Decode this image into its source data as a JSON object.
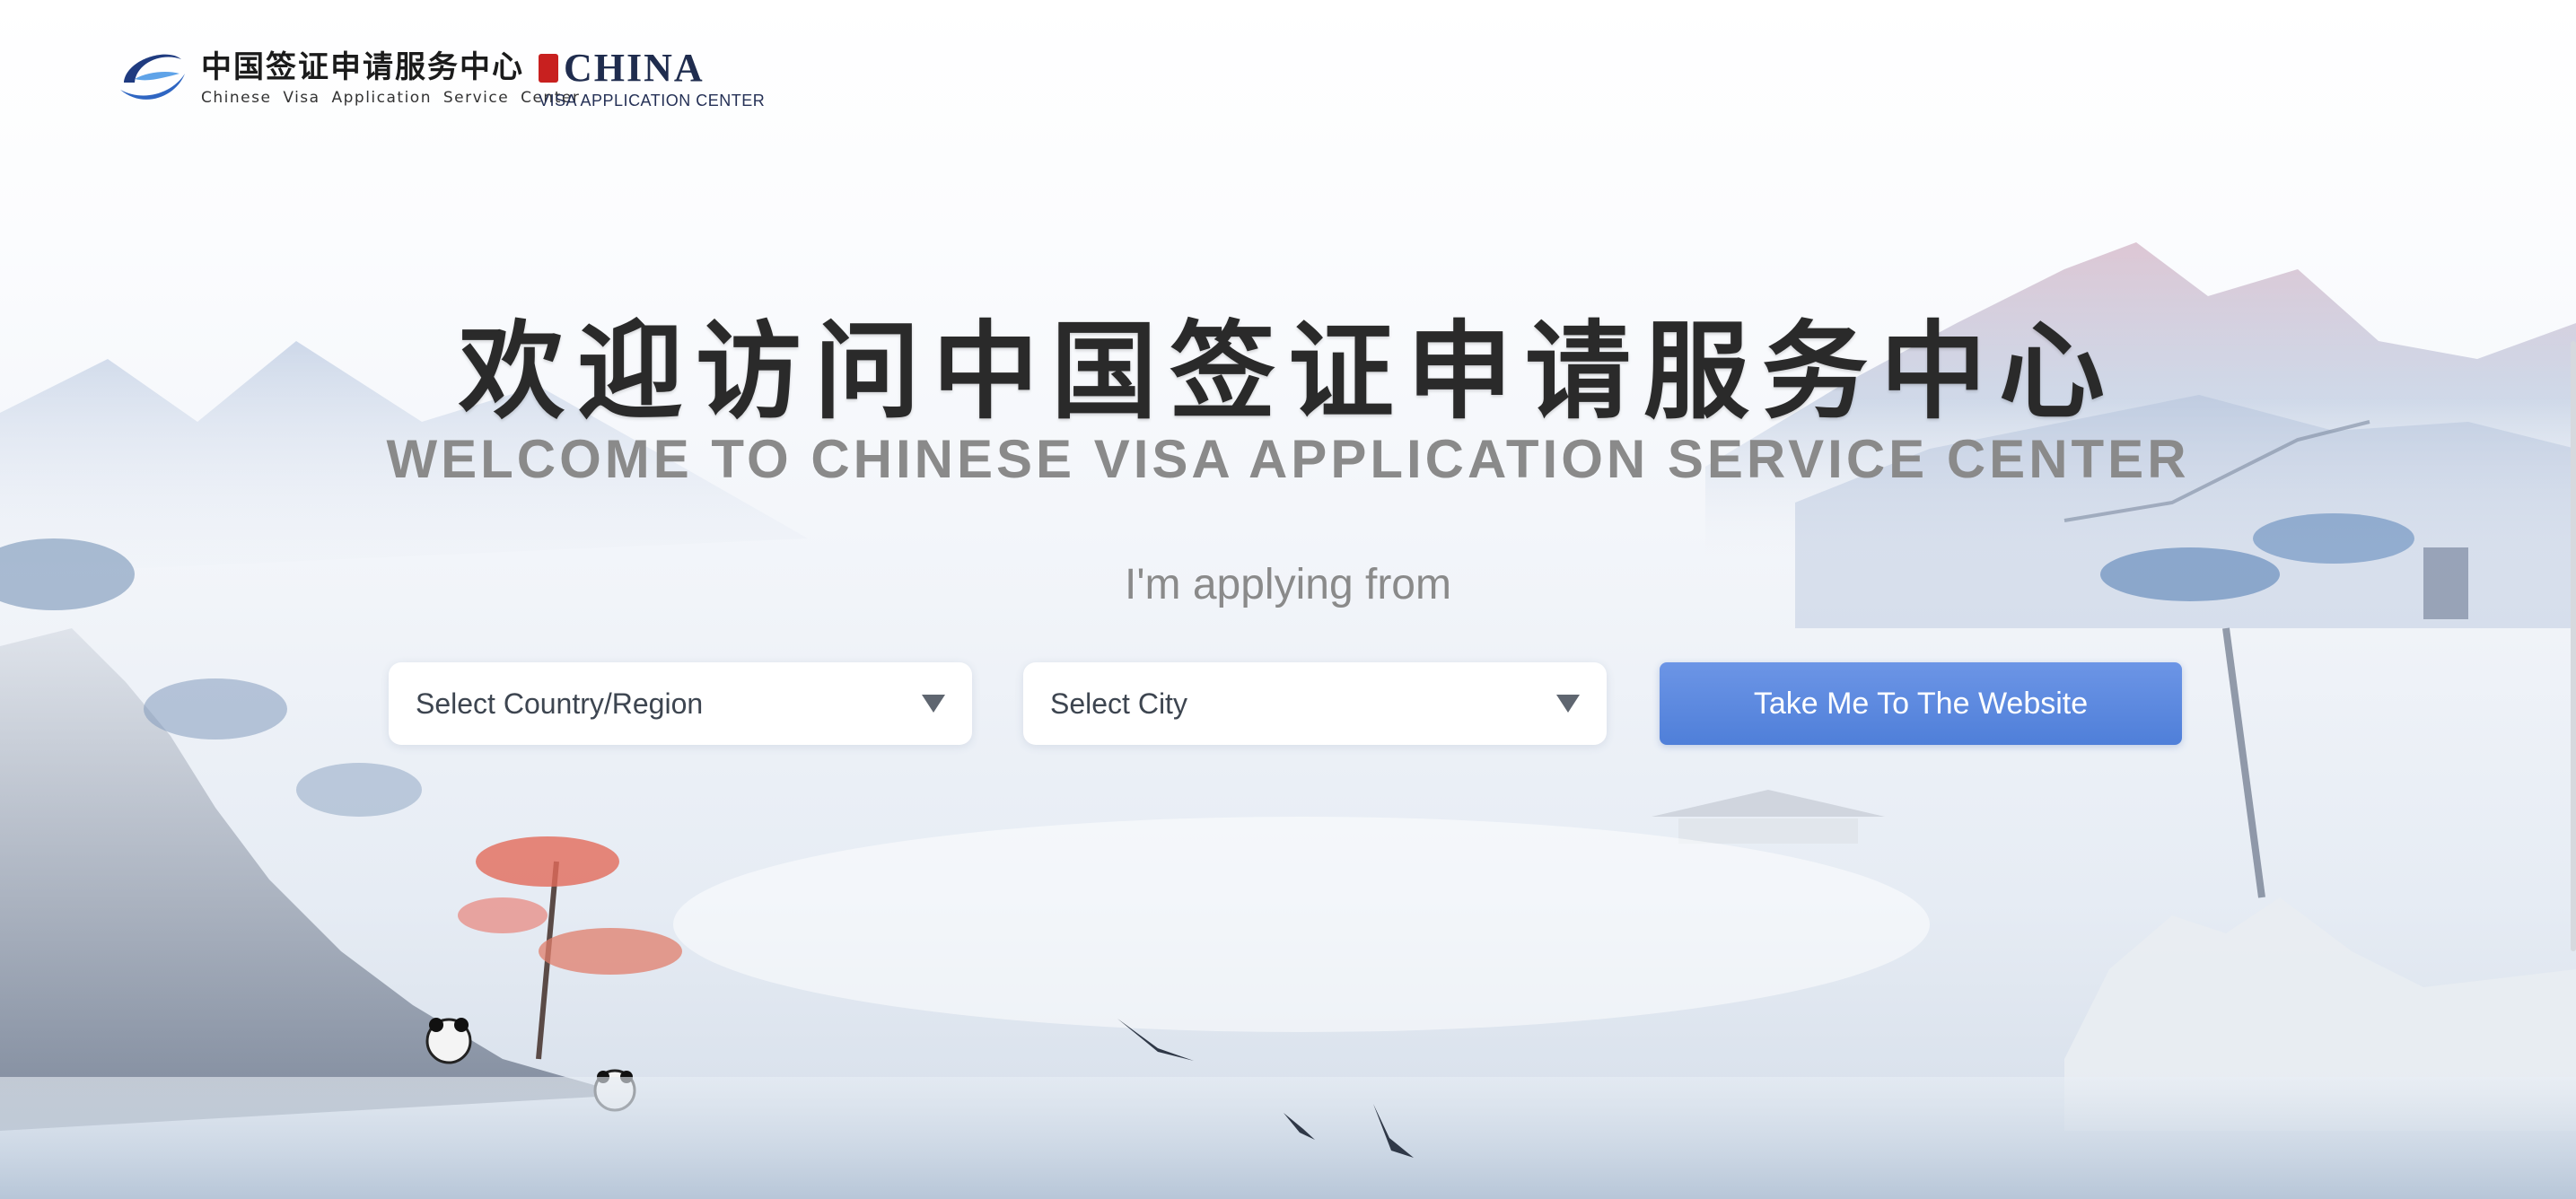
{
  "header": {
    "cvasc_logo_zh": "中国签证申请服务中心",
    "cvasc_logo_en": "Chinese Visa Application Service Center",
    "china_logo_word": "CHINA",
    "china_logo_sub": "VISA APPLICATION CENTER"
  },
  "hero": {
    "title_zh": "欢迎访问中国签证申请服务中心",
    "title_en": "WELCOME TO CHINESE VISA APPLICATION SERVICE CENTER",
    "subtitle": "I'm applying from"
  },
  "form": {
    "country_select": "Select Country/Region",
    "city_select": "Select City",
    "submit_label": "Take Me To The Website"
  },
  "colors": {
    "button": "#5a87dd",
    "title": "#2a2a2a",
    "subtitle": "#8a8a8a"
  },
  "icons": [
    "cvasc-logo-icon",
    "china-seal-icon",
    "dropdown-caret-icon"
  ]
}
